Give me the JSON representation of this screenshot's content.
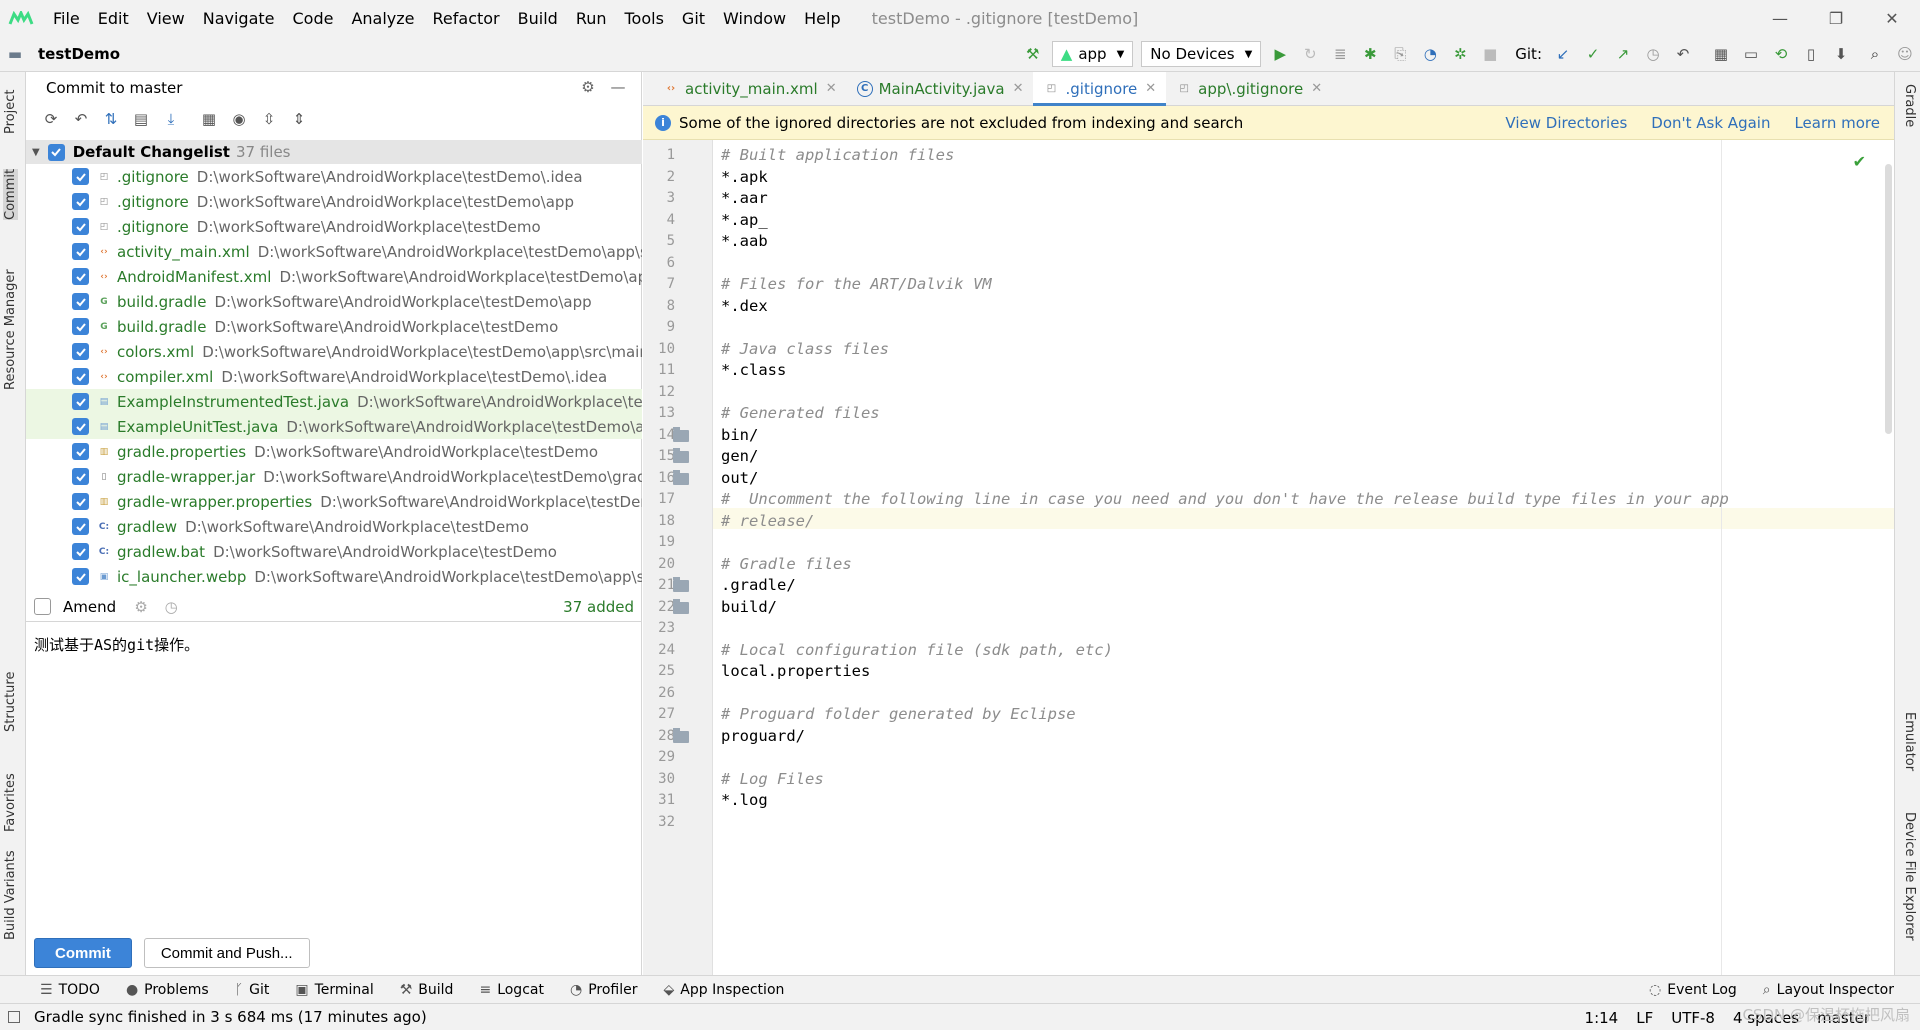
{
  "menubar": {
    "items": [
      "File",
      "Edit",
      "View",
      "Navigate",
      "Code",
      "Analyze",
      "Refactor",
      "Build",
      "Run",
      "Tools",
      "Git",
      "Window",
      "Help"
    ],
    "window_title": "testDemo - .gitignore [testDemo]",
    "window_buttons": [
      "—",
      "❐",
      "✕"
    ]
  },
  "toolbar": {
    "project": "testDemo",
    "run_config": "app",
    "devices": "No Devices",
    "git_label": "Git:"
  },
  "left_strip": {
    "project": "Project",
    "commit": "Commit",
    "resource_manager": "Resource Manager",
    "structure": "Structure",
    "favorites": "Favorites",
    "build_variants": "Build Variants"
  },
  "right_strip": {
    "gradle": "Gradle",
    "emulator": "Emulator",
    "device_file_explorer": "Device File Explorer"
  },
  "commit_panel": {
    "title": "Commit to master",
    "changelist": {
      "name": "Default Changelist",
      "count": "37 files"
    },
    "files": [
      {
        "name": ".gitignore",
        "path": "D:\\workSoftware\\AndroidWorkplace\\testDemo\\.idea",
        "icon": "gitignore-icon",
        "highlight": false
      },
      {
        "name": ".gitignore",
        "path": "D:\\workSoftware\\AndroidWorkplace\\testDemo\\app",
        "icon": "gitignore-icon",
        "highlight": false
      },
      {
        "name": ".gitignore",
        "path": "D:\\workSoftware\\AndroidWorkplace\\testDemo",
        "icon": "gitignore-icon",
        "highlight": false
      },
      {
        "name": "activity_main.xml",
        "path": "D:\\workSoftware\\AndroidWorkplace\\testDemo\\app\\src",
        "icon": "xml-icon",
        "highlight": false
      },
      {
        "name": "AndroidManifest.xml",
        "path": "D:\\workSoftware\\AndroidWorkplace\\testDemo\\app",
        "icon": "xml-icon",
        "highlight": false
      },
      {
        "name": "build.gradle",
        "path": "D:\\workSoftware\\AndroidWorkplace\\testDemo\\app",
        "icon": "gradle-icon",
        "highlight": false
      },
      {
        "name": "build.gradle",
        "path": "D:\\workSoftware\\AndroidWorkplace\\testDemo",
        "icon": "gradle-icon",
        "highlight": false
      },
      {
        "name": "colors.xml",
        "path": "D:\\workSoftware\\AndroidWorkplace\\testDemo\\app\\src\\main",
        "icon": "xml-icon",
        "highlight": false
      },
      {
        "name": "compiler.xml",
        "path": "D:\\workSoftware\\AndroidWorkplace\\testDemo\\.idea",
        "icon": "xml-icon",
        "highlight": false
      },
      {
        "name": "ExampleInstrumentedTest.java",
        "path": "D:\\workSoftware\\AndroidWorkplace\\testDemo",
        "icon": "java-test-icon",
        "highlight": true
      },
      {
        "name": "ExampleUnitTest.java",
        "path": "D:\\workSoftware\\AndroidWorkplace\\testDemo\\app",
        "icon": "java-test-icon",
        "highlight": true
      },
      {
        "name": "gradle.properties",
        "path": "D:\\workSoftware\\AndroidWorkplace\\testDemo",
        "icon": "properties-icon",
        "highlight": false
      },
      {
        "name": "gradle-wrapper.jar",
        "path": "D:\\workSoftware\\AndroidWorkplace\\testDemo\\gradle",
        "icon": "jar-icon",
        "highlight": false
      },
      {
        "name": "gradle-wrapper.properties",
        "path": "D:\\workSoftware\\AndroidWorkplace\\testDemo",
        "icon": "properties-icon",
        "highlight": false
      },
      {
        "name": "gradlew",
        "path": "D:\\workSoftware\\AndroidWorkplace\\testDemo",
        "icon": "script-icon",
        "highlight": false
      },
      {
        "name": "gradlew.bat",
        "path": "D:\\workSoftware\\AndroidWorkplace\\testDemo",
        "icon": "script-icon",
        "highlight": false
      },
      {
        "name": "ic_launcher.webp",
        "path": "D:\\workSoftware\\AndroidWorkplace\\testDemo\\app\\s",
        "icon": "image-icon",
        "highlight": false
      }
    ],
    "amend_label": "Amend",
    "added_status": "37 added",
    "commit_message": "测试基于AS的git操作。",
    "commit_button": "Commit",
    "commit_push_button": "Commit and Push..."
  },
  "editor": {
    "tabs": [
      {
        "label": "activity_main.xml",
        "icon": "xml-icon",
        "active": false
      },
      {
        "label": "MainActivity.java",
        "icon": "java-class-icon",
        "active": false
      },
      {
        "label": ".gitignore",
        "icon": "gitignore-icon",
        "active": true
      },
      {
        "label": "app\\.gitignore",
        "icon": "gitignore-icon",
        "active": false
      }
    ],
    "banner": {
      "text": "Some of the ignored directories are not excluded from indexing and search",
      "links": [
        "View Directories",
        "Don't Ask Again",
        "Learn more"
      ]
    },
    "lines": [
      {
        "n": "1",
        "t": "# Built application files",
        "c": true,
        "f": false
      },
      {
        "n": "2",
        "t": "*.apk",
        "c": false,
        "f": false
      },
      {
        "n": "3",
        "t": "*.aar",
        "c": false,
        "f": false
      },
      {
        "n": "4",
        "t": "*.ap_",
        "c": false,
        "f": false
      },
      {
        "n": "5",
        "t": "*.aab",
        "c": false,
        "f": false
      },
      {
        "n": "6",
        "t": "",
        "c": false,
        "f": false
      },
      {
        "n": "7",
        "t": "# Files for the ART/Dalvik VM",
        "c": true,
        "f": false
      },
      {
        "n": "8",
        "t": "*.dex",
        "c": false,
        "f": false
      },
      {
        "n": "9",
        "t": "",
        "c": false,
        "f": false
      },
      {
        "n": "10",
        "t": "# Java class files",
        "c": true,
        "f": false
      },
      {
        "n": "11",
        "t": "*.class",
        "c": false,
        "f": false
      },
      {
        "n": "12",
        "t": "",
        "c": false,
        "f": false
      },
      {
        "n": "13",
        "t": "# Generated files",
        "c": true,
        "f": false
      },
      {
        "n": "14",
        "t": "bin/",
        "c": false,
        "f": true
      },
      {
        "n": "15",
        "t": "gen/",
        "c": false,
        "f": true
      },
      {
        "n": "16",
        "t": "out/",
        "c": false,
        "f": true
      },
      {
        "n": "17",
        "t": "#  Uncomment the following line in case you need and you don't have the release build type files in your app",
        "c": true,
        "f": false
      },
      {
        "n": "18",
        "t": "# release/",
        "c": true,
        "f": false
      },
      {
        "n": "19",
        "t": "",
        "c": false,
        "f": false
      },
      {
        "n": "20",
        "t": "# Gradle files",
        "c": true,
        "f": false
      },
      {
        "n": "21",
        "t": ".gradle/",
        "c": false,
        "f": true
      },
      {
        "n": "22",
        "t": "build/",
        "c": false,
        "f": true
      },
      {
        "n": "23",
        "t": "",
        "c": false,
        "f": false
      },
      {
        "n": "24",
        "t": "# Local configuration file (sdk path, etc)",
        "c": true,
        "f": false
      },
      {
        "n": "25",
        "t": "local.properties",
        "c": false,
        "f": false
      },
      {
        "n": "26",
        "t": "",
        "c": false,
        "f": false
      },
      {
        "n": "27",
        "t": "# Proguard folder generated by Eclipse",
        "c": true,
        "f": false
      },
      {
        "n": "28",
        "t": "proguard/",
        "c": false,
        "f": true
      },
      {
        "n": "29",
        "t": "",
        "c": false,
        "f": false
      },
      {
        "n": "30",
        "t": "# Log Files",
        "c": true,
        "f": false
      },
      {
        "n": "31",
        "t": "*.log",
        "c": false,
        "f": false
      },
      {
        "n": "32",
        "t": "",
        "c": false,
        "f": false
      }
    ]
  },
  "bottom_tools": {
    "left": [
      "TODO",
      "Problems",
      "Git",
      "Terminal",
      "Build",
      "Logcat",
      "Profiler",
      "App Inspection"
    ],
    "right": [
      "Event Log",
      "Layout Inspector"
    ]
  },
  "statusbar": {
    "message": "Gradle sync finished in 3 s 684 ms (17 minutes ago)",
    "position": "1:14",
    "line_sep": "LF",
    "encoding": "UTF-8",
    "indent": "4 spaces",
    "branch": "master",
    "watermark": "CSDN @保温杯拖把风扇"
  }
}
